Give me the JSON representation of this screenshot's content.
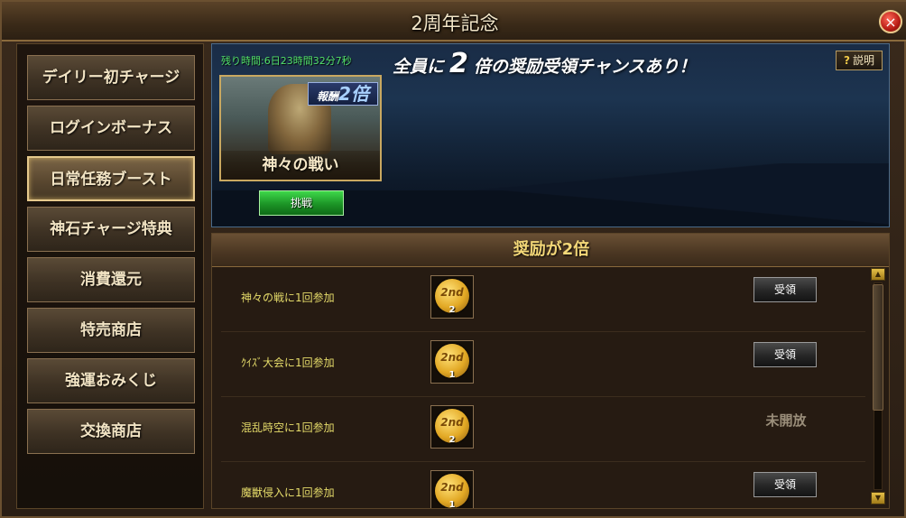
{
  "window": {
    "title": "2周年記念",
    "close_icon": "×"
  },
  "sidebar": {
    "items": [
      {
        "label": "デイリー初チャージ"
      },
      {
        "label": "ログインボーナス"
      },
      {
        "label": "日常任務ブースト"
      },
      {
        "label": "神石チャージ特典"
      },
      {
        "label": "消費還元"
      },
      {
        "label": "特売商店"
      },
      {
        "label": "強運おみくじ"
      },
      {
        "label": "交換商店"
      }
    ],
    "active": "日常任務ブースト"
  },
  "banner": {
    "timer": "残り時間:6日23時間32分7秒",
    "headline_pre": "全員に",
    "headline_num": "2",
    "headline_post": "倍の奨励受領チャンスあり！",
    "help_icon": "?",
    "help_label": "説明",
    "event_card": {
      "badge_text": "報酬",
      "badge_num": "2倍",
      "label": "神々の戦い"
    },
    "challenge_label": "挑戦"
  },
  "rewards": {
    "header": "奨励が2倍",
    "rows": [
      {
        "label": "神々の戦に1回参加",
        "medal_text": "2nd",
        "count": "2",
        "action": "受領"
      },
      {
        "label": "ｸｲｽﾞ大会に1回参加",
        "medal_text": "2nd",
        "count": "1",
        "action": "受領"
      },
      {
        "label": "混乱時空に1回参加",
        "medal_text": "2nd",
        "count": "2",
        "status": "未開放"
      },
      {
        "label": "魔獣侵入に1回参加",
        "medal_text": "2nd",
        "count": "1",
        "action": "受領"
      }
    ]
  },
  "scrollbar": {
    "up_icon": "▲",
    "down_icon": "▼"
  }
}
